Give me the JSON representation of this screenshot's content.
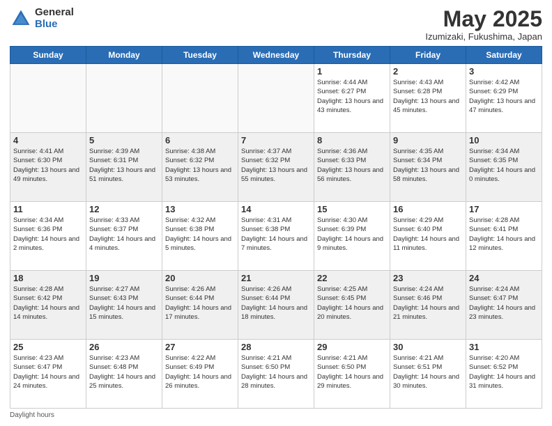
{
  "header": {
    "logo_general": "General",
    "logo_blue": "Blue",
    "month_title": "May 2025",
    "location": "Izumizaki, Fukushima, Japan"
  },
  "days_of_week": [
    "Sunday",
    "Monday",
    "Tuesday",
    "Wednesday",
    "Thursday",
    "Friday",
    "Saturday"
  ],
  "footer": {
    "daylight_label": "Daylight hours"
  },
  "weeks": [
    [
      {
        "day": "",
        "info": ""
      },
      {
        "day": "",
        "info": ""
      },
      {
        "day": "",
        "info": ""
      },
      {
        "day": "",
        "info": ""
      },
      {
        "day": "1",
        "info": "Sunrise: 4:44 AM\nSunset: 6:27 PM\nDaylight: 13 hours\nand 43 minutes."
      },
      {
        "day": "2",
        "info": "Sunrise: 4:43 AM\nSunset: 6:28 PM\nDaylight: 13 hours\nand 45 minutes."
      },
      {
        "day": "3",
        "info": "Sunrise: 4:42 AM\nSunset: 6:29 PM\nDaylight: 13 hours\nand 47 minutes."
      }
    ],
    [
      {
        "day": "4",
        "info": "Sunrise: 4:41 AM\nSunset: 6:30 PM\nDaylight: 13 hours\nand 49 minutes."
      },
      {
        "day": "5",
        "info": "Sunrise: 4:39 AM\nSunset: 6:31 PM\nDaylight: 13 hours\nand 51 minutes."
      },
      {
        "day": "6",
        "info": "Sunrise: 4:38 AM\nSunset: 6:32 PM\nDaylight: 13 hours\nand 53 minutes."
      },
      {
        "day": "7",
        "info": "Sunrise: 4:37 AM\nSunset: 6:32 PM\nDaylight: 13 hours\nand 55 minutes."
      },
      {
        "day": "8",
        "info": "Sunrise: 4:36 AM\nSunset: 6:33 PM\nDaylight: 13 hours\nand 56 minutes."
      },
      {
        "day": "9",
        "info": "Sunrise: 4:35 AM\nSunset: 6:34 PM\nDaylight: 13 hours\nand 58 minutes."
      },
      {
        "day": "10",
        "info": "Sunrise: 4:34 AM\nSunset: 6:35 PM\nDaylight: 14 hours\nand 0 minutes."
      }
    ],
    [
      {
        "day": "11",
        "info": "Sunrise: 4:34 AM\nSunset: 6:36 PM\nDaylight: 14 hours\nand 2 minutes."
      },
      {
        "day": "12",
        "info": "Sunrise: 4:33 AM\nSunset: 6:37 PM\nDaylight: 14 hours\nand 4 minutes."
      },
      {
        "day": "13",
        "info": "Sunrise: 4:32 AM\nSunset: 6:38 PM\nDaylight: 14 hours\nand 5 minutes."
      },
      {
        "day": "14",
        "info": "Sunrise: 4:31 AM\nSunset: 6:38 PM\nDaylight: 14 hours\nand 7 minutes."
      },
      {
        "day": "15",
        "info": "Sunrise: 4:30 AM\nSunset: 6:39 PM\nDaylight: 14 hours\nand 9 minutes."
      },
      {
        "day": "16",
        "info": "Sunrise: 4:29 AM\nSunset: 6:40 PM\nDaylight: 14 hours\nand 11 minutes."
      },
      {
        "day": "17",
        "info": "Sunrise: 4:28 AM\nSunset: 6:41 PM\nDaylight: 14 hours\nand 12 minutes."
      }
    ],
    [
      {
        "day": "18",
        "info": "Sunrise: 4:28 AM\nSunset: 6:42 PM\nDaylight: 14 hours\nand 14 minutes."
      },
      {
        "day": "19",
        "info": "Sunrise: 4:27 AM\nSunset: 6:43 PM\nDaylight: 14 hours\nand 15 minutes."
      },
      {
        "day": "20",
        "info": "Sunrise: 4:26 AM\nSunset: 6:44 PM\nDaylight: 14 hours\nand 17 minutes."
      },
      {
        "day": "21",
        "info": "Sunrise: 4:26 AM\nSunset: 6:44 PM\nDaylight: 14 hours\nand 18 minutes."
      },
      {
        "day": "22",
        "info": "Sunrise: 4:25 AM\nSunset: 6:45 PM\nDaylight: 14 hours\nand 20 minutes."
      },
      {
        "day": "23",
        "info": "Sunrise: 4:24 AM\nSunset: 6:46 PM\nDaylight: 14 hours\nand 21 minutes."
      },
      {
        "day": "24",
        "info": "Sunrise: 4:24 AM\nSunset: 6:47 PM\nDaylight: 14 hours\nand 23 minutes."
      }
    ],
    [
      {
        "day": "25",
        "info": "Sunrise: 4:23 AM\nSunset: 6:47 PM\nDaylight: 14 hours\nand 24 minutes."
      },
      {
        "day": "26",
        "info": "Sunrise: 4:23 AM\nSunset: 6:48 PM\nDaylight: 14 hours\nand 25 minutes."
      },
      {
        "day": "27",
        "info": "Sunrise: 4:22 AM\nSunset: 6:49 PM\nDaylight: 14 hours\nand 26 minutes."
      },
      {
        "day": "28",
        "info": "Sunrise: 4:21 AM\nSunset: 6:50 PM\nDaylight: 14 hours\nand 28 minutes."
      },
      {
        "day": "29",
        "info": "Sunrise: 4:21 AM\nSunset: 6:50 PM\nDaylight: 14 hours\nand 29 minutes."
      },
      {
        "day": "30",
        "info": "Sunrise: 4:21 AM\nSunset: 6:51 PM\nDaylight: 14 hours\nand 30 minutes."
      },
      {
        "day": "31",
        "info": "Sunrise: 4:20 AM\nSunset: 6:52 PM\nDaylight: 14 hours\nand 31 minutes."
      }
    ]
  ]
}
